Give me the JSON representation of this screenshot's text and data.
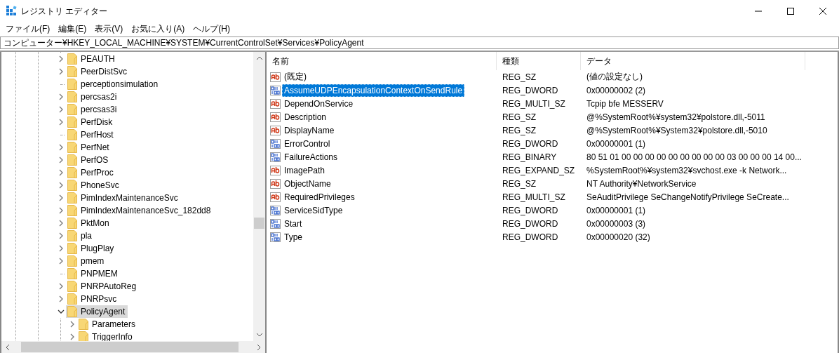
{
  "window": {
    "title": "レジストリ エディター"
  },
  "menu": [
    "ファイル(F)",
    "編集(E)",
    "表示(V)",
    "お気に入り(A)",
    "ヘルプ(H)"
  ],
  "address": "コンピューター¥HKEY_LOCAL_MACHINE¥SYSTEM¥CurrentControlSet¥Services¥PolicyAgent",
  "tree": [
    {
      "label": "PEAUTH",
      "kind": "collapsed",
      "selected": false
    },
    {
      "label": "PeerDistSvc",
      "kind": "collapsed",
      "selected": false
    },
    {
      "label": "perceptionsimulation",
      "kind": "leaf",
      "selected": false
    },
    {
      "label": "percsas2i",
      "kind": "collapsed",
      "selected": false
    },
    {
      "label": "percsas3i",
      "kind": "collapsed",
      "selected": false
    },
    {
      "label": "PerfDisk",
      "kind": "collapsed",
      "selected": false
    },
    {
      "label": "PerfHost",
      "kind": "leaf",
      "selected": false
    },
    {
      "label": "PerfNet",
      "kind": "collapsed",
      "selected": false
    },
    {
      "label": "PerfOS",
      "kind": "collapsed",
      "selected": false
    },
    {
      "label": "PerfProc",
      "kind": "collapsed",
      "selected": false
    },
    {
      "label": "PhoneSvc",
      "kind": "collapsed",
      "selected": false
    },
    {
      "label": "PimIndexMaintenanceSvc",
      "kind": "collapsed",
      "selected": false
    },
    {
      "label": "PimIndexMaintenanceSvc_182dd8",
      "kind": "collapsed",
      "selected": false
    },
    {
      "label": "PktMon",
      "kind": "collapsed",
      "selected": false
    },
    {
      "label": "pla",
      "kind": "collapsed",
      "selected": false
    },
    {
      "label": "PlugPlay",
      "kind": "collapsed",
      "selected": false
    },
    {
      "label": "pmem",
      "kind": "collapsed",
      "selected": false
    },
    {
      "label": "PNPMEM",
      "kind": "leaf",
      "selected": false
    },
    {
      "label": "PNRPAutoReg",
      "kind": "collapsed",
      "selected": false
    },
    {
      "label": "PNRPsvc",
      "kind": "collapsed",
      "selected": false
    },
    {
      "label": "PolicyAgent",
      "kind": "expanded",
      "selected": true,
      "children": [
        {
          "label": "Parameters",
          "kind": "collapsed",
          "selected": false
        },
        {
          "label": "TriggerInfo",
          "kind": "collapsed",
          "selected": false
        }
      ]
    }
  ],
  "table": {
    "columns": [
      "名前",
      "種類",
      "データ"
    ],
    "rows": [
      {
        "name": "(既定)",
        "kind": "string",
        "type": "REG_SZ",
        "data": "(値の設定なし)",
        "selected": false
      },
      {
        "name": "AssumeUDPEncapsulationContextOnSendRule",
        "kind": "binary",
        "type": "REG_DWORD",
        "data": "0x00000002 (2)",
        "selected": true
      },
      {
        "name": "DependOnService",
        "kind": "string",
        "type": "REG_MULTI_SZ",
        "data": "Tcpip bfe MESSERV",
        "selected": false
      },
      {
        "name": "Description",
        "kind": "string",
        "type": "REG_SZ",
        "data": "@%SystemRoot%¥system32¥polstore.dll,-5011",
        "selected": false
      },
      {
        "name": "DisplayName",
        "kind": "string",
        "type": "REG_SZ",
        "data": "@%SystemRoot%¥System32¥polstore.dll,-5010",
        "selected": false
      },
      {
        "name": "ErrorControl",
        "kind": "binary",
        "type": "REG_DWORD",
        "data": "0x00000001 (1)",
        "selected": false
      },
      {
        "name": "FailureActions",
        "kind": "binary",
        "type": "REG_BINARY",
        "data": "80 51 01 00 00 00 00 00 00 00 00 00 03 00 00 00 14 00...",
        "selected": false
      },
      {
        "name": "ImagePath",
        "kind": "string",
        "type": "REG_EXPAND_SZ",
        "data": "%SystemRoot%¥system32¥svchost.exe -k Network...",
        "selected": false
      },
      {
        "name": "ObjectName",
        "kind": "string",
        "type": "REG_SZ",
        "data": "NT Authority¥NetworkService",
        "selected": false
      },
      {
        "name": "RequiredPrivileges",
        "kind": "string",
        "type": "REG_MULTI_SZ",
        "data": "SeAuditPrivilege SeChangeNotifyPrivilege SeCreate...",
        "selected": false
      },
      {
        "name": "ServiceSidType",
        "kind": "binary",
        "type": "REG_DWORD",
        "data": "0x00000001 (1)",
        "selected": false
      },
      {
        "name": "Start",
        "kind": "binary",
        "type": "REG_DWORD",
        "data": "0x00000003 (3)",
        "selected": false
      },
      {
        "name": "Type",
        "kind": "binary",
        "type": "REG_DWORD",
        "data": "0x00000020 (32)",
        "selected": false
      }
    ]
  }
}
